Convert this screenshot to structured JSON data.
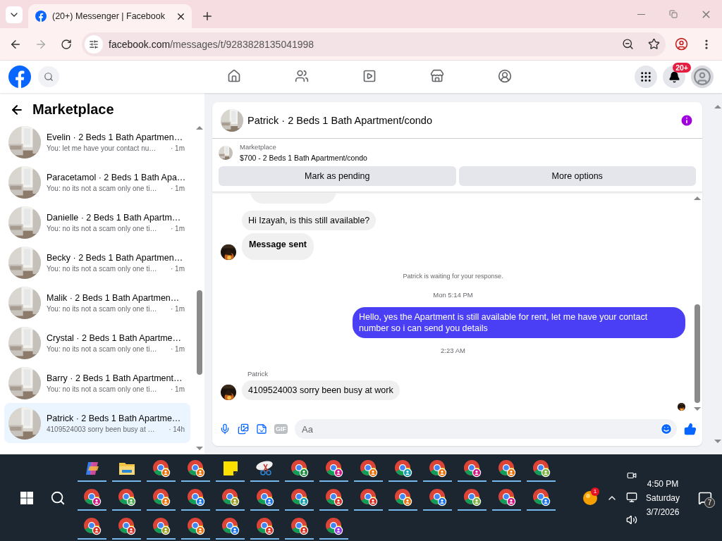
{
  "browser": {
    "tabs": [
      {
        "title": "(20+) Messenger | Facebook",
        "selected": true
      }
    ],
    "url_host": "facebook.com",
    "url_path": "/messages/t/9283828135041998"
  },
  "header": {
    "nav": [
      {
        "kind": "home",
        "selected": false
      },
      {
        "kind": "friends",
        "selected": false
      },
      {
        "kind": "video",
        "selected": false
      },
      {
        "kind": "marketplace",
        "selected": false
      },
      {
        "kind": "groups",
        "selected": false
      }
    ],
    "notifications_badge": "20+"
  },
  "sidebar": {
    "title": "Marketplace",
    "conversations": [
      {
        "name": "Evelin · 2 Beds 1 Bath Apartmen…",
        "preview": "You: let me have your contact nu…",
        "time": "· 1m",
        "selected": false
      },
      {
        "name": "Paracetamol · 2 Beds 1 Bath Apa…",
        "preview": "You: no its not a scam only one ti…",
        "time": "· 1m",
        "selected": false
      },
      {
        "name": "Danielle · 2 Beds 1 Bath Apartm…",
        "preview": "You: no its not a scam only one ti…",
        "time": "· 1m",
        "selected": false
      },
      {
        "name": "Becky · 2 Beds 1 Bath Apartmen…",
        "preview": "You: no its not a scam only one ti…",
        "time": "· 1m",
        "selected": false
      },
      {
        "name": "Malik · 2 Beds 1 Bath Apartmen…",
        "preview": "You: no its not a scam only one ti…",
        "time": "· 1m",
        "selected": false
      },
      {
        "name": "Crystal · 2 Beds 1 Bath Apartme…",
        "preview": "You: no its not a scam only one ti…",
        "time": "· 1m",
        "selected": false
      },
      {
        "name": "Barry · 2 Beds 1 Bath Apartment…",
        "preview": "You: no its not a scam only one ti…",
        "time": "· 1m",
        "selected": false
      },
      {
        "name": "Patrick · 2 Beds 1 Bath Apartme…",
        "preview": "4109524003 sorry been busy at …",
        "time": "· 14h",
        "selected": true
      }
    ]
  },
  "chat": {
    "title": "Patrick · 2 Beds 1 Bath Apartment/condo",
    "listing": {
      "source": "Marketplace",
      "item": "$700 - 2 Beds 1 Bath Apartment/condo"
    },
    "actions": [
      "Mark as pending",
      "More options"
    ],
    "messages": [
      {
        "kind": "incoming",
        "text": "Hi Izayah, is this still available?",
        "avatar": false,
        "bold": false
      },
      {
        "kind": "incoming",
        "text": "Message sent",
        "avatar": true,
        "bold": true
      },
      {
        "kind": "notice",
        "text": "Patrick is waiting for your response."
      },
      {
        "kind": "timestamp",
        "text": "Mon 5:14 PM"
      },
      {
        "kind": "outgoing",
        "text": "Hello, yes the Apartment is still available for rent, let me have your contact number so i can send you details"
      },
      {
        "kind": "timestamp",
        "text": "2:23 AM"
      },
      {
        "kind": "sender",
        "text": "Patrick"
      },
      {
        "kind": "incoming",
        "text": "4109524003 sorry been busy at work",
        "avatar": true,
        "bold": false
      }
    ],
    "composer": {
      "placeholder": "Aa",
      "gif": "GIF"
    }
  },
  "taskbar": {
    "apps": [
      [
        {
          "kind": "copilot"
        },
        {
          "kind": "folder"
        },
        {
          "kind": "browser",
          "color": "#e8710a"
        },
        {
          "kind": "browser",
          "color": "#e8710a"
        },
        {
          "kind": "notes"
        },
        {
          "kind": "snip"
        },
        {
          "kind": "browser",
          "color": "#1e8e3e"
        },
        {
          "kind": "browser",
          "color": "#d01884"
        },
        {
          "kind": "browser",
          "color": "#e8710a"
        },
        {
          "kind": "browser",
          "color": "#129eaf"
        },
        {
          "kind": "browser",
          "color": "#e8710a"
        },
        {
          "kind": "browser",
          "color": "#d01884"
        },
        {
          "kind": "browser",
          "color": "#e8710a"
        },
        {
          "kind": "browser",
          "color": "#7cb342"
        }
      ],
      [
        {
          "kind": "browser",
          "color": "#d01884"
        },
        {
          "kind": "browser",
          "color": "#4caf50"
        },
        {
          "kind": "browser",
          "color": "#e8710a"
        },
        {
          "kind": "browser",
          "color": "#1a73e8"
        },
        {
          "kind": "browser",
          "color": "#9e9d24"
        },
        {
          "kind": "browser",
          "color": "#1a73e8"
        },
        {
          "kind": "browser",
          "color": "#129eaf"
        },
        {
          "kind": "browser",
          "color": "#d93025"
        },
        {
          "kind": "browser",
          "color": "#d93025"
        },
        {
          "kind": "browser",
          "color": "#e8710a"
        },
        {
          "kind": "browser",
          "color": "#1a73e8"
        },
        {
          "kind": "browser",
          "color": "#7cb342"
        },
        {
          "kind": "browser",
          "color": "#d01884"
        },
        {
          "kind": "browser",
          "color": "#1a73e8"
        }
      ],
      [
        {
          "kind": "browser",
          "color": "#d93025"
        },
        {
          "kind": "browser",
          "color": "#d93025"
        },
        {
          "kind": "browser",
          "color": "#9e9d24"
        },
        {
          "kind": "browser",
          "color": "#e8710a"
        },
        {
          "kind": "browser",
          "color": "#1a73e8"
        },
        {
          "kind": "browser",
          "color": "#d93025"
        },
        {
          "kind": "browser",
          "color": "#d93025"
        },
        {
          "kind": "browser",
          "color": "#9334e6"
        }
      ]
    ],
    "tray_app_badge": "1",
    "time": "4:50 PM",
    "day": "Saturday",
    "date": "3/7/2026",
    "notifications_badge": "7"
  }
}
